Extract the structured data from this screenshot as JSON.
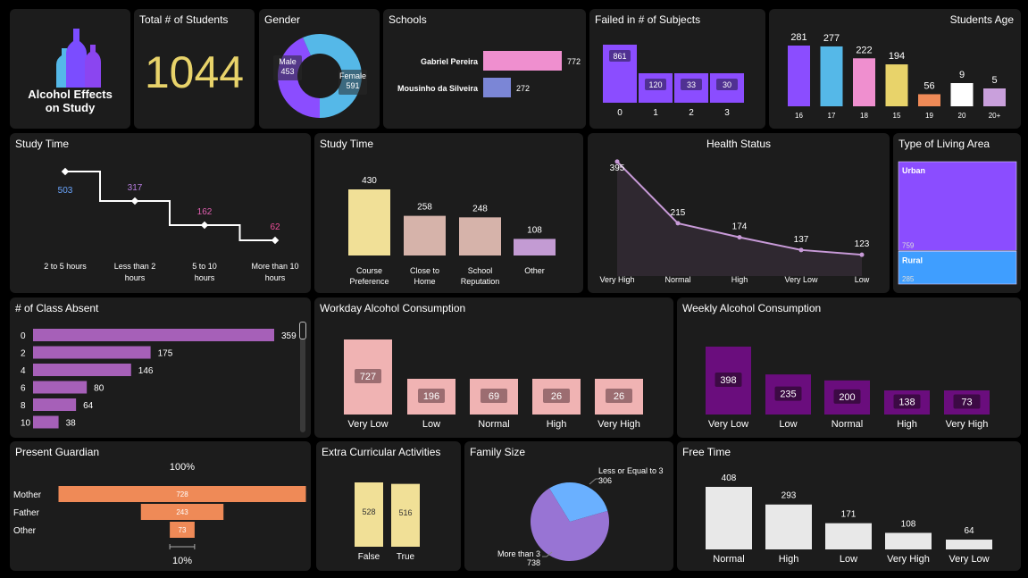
{
  "logo": {
    "title_line1": "Alcohol Effects",
    "title_line2": "on Study",
    "colors": [
      "#7b4dff",
      "#55b8e8",
      "#8b45f0"
    ]
  },
  "total": {
    "title": "Total # of Students",
    "value": "1044",
    "color": "#e8d36a"
  },
  "chart_data": [
    {
      "id": "gender",
      "type": "pie",
      "title": "Gender",
      "slices": [
        {
          "label": "Male",
          "value": 453,
          "color": "#8b4dff"
        },
        {
          "label": "Female",
          "value": 591,
          "color": "#55b8e8"
        }
      ]
    },
    {
      "id": "schools",
      "type": "bar",
      "orientation": "horizontal",
      "title": "Schools",
      "categories": [
        "Gabriel Pereira",
        "Mousinho da Silveira"
      ],
      "values": [
        772,
        272
      ],
      "colors": [
        "#ef8fcf",
        "#7b86d6"
      ]
    },
    {
      "id": "failed",
      "type": "bar",
      "title": "Failed in # of Subjects",
      "categories": [
        "0",
        "1",
        "2",
        "3"
      ],
      "values": [
        861,
        120,
        33,
        30
      ],
      "color": "#8b4dff"
    },
    {
      "id": "age",
      "type": "bar",
      "title": "Students Age",
      "categories": [
        "16",
        "17",
        "18",
        "15",
        "19",
        "20",
        "20+"
      ],
      "values": [
        281,
        277,
        222,
        194,
        56,
        9,
        5
      ],
      "colors": [
        "#8b4dff",
        "#55b8e8",
        "#ef8fcf",
        "#e8d36a",
        "#ef8a57",
        "#ffffff",
        "#c9a0dc"
      ]
    },
    {
      "id": "studytime_line",
      "type": "line",
      "title": "Study Time",
      "categories": [
        "2 to 5 hours",
        "Less than 2 hours",
        "5 to 10 hours",
        "More than 10 hours"
      ],
      "values": [
        503,
        317,
        162,
        62
      ],
      "label_colors": [
        "#6aa6ff",
        "#b67ddf",
        "#e05fb0",
        "#ef4f9a"
      ]
    },
    {
      "id": "studytime_bar",
      "type": "bar",
      "title": "Study Time",
      "categories": [
        "Course Preference",
        "Close to Home",
        "School Reputation",
        "Other"
      ],
      "values": [
        430,
        258,
        248,
        108
      ],
      "colors": [
        "#f1e097",
        "#d6b3aa",
        "#d6b3aa",
        "#c39bd3"
      ]
    },
    {
      "id": "health",
      "type": "area",
      "title": "Health Status",
      "categories": [
        "Very High",
        "Normal",
        "High",
        "Very Low",
        "Low"
      ],
      "values": [
        395,
        215,
        174,
        137,
        123
      ],
      "color": "#c89ad8"
    },
    {
      "id": "living",
      "type": "treemap",
      "title": "Type of Living Area",
      "items": [
        {
          "label": "Urban",
          "value": 759,
          "color": "#8b4dff"
        },
        {
          "label": "Rural",
          "value": 285,
          "color": "#3f9eff"
        }
      ]
    },
    {
      "id": "absent",
      "type": "bar",
      "orientation": "horizontal",
      "title": "# of Class Absent",
      "categories": [
        "0",
        "2",
        "4",
        "6",
        "8",
        "10"
      ],
      "values": [
        359,
        175,
        146,
        80,
        64,
        38
      ],
      "color": "#a660b8"
    },
    {
      "id": "workday",
      "type": "bar",
      "title": "Workday Alcohol Consumption",
      "categories": [
        "Very Low",
        "Low",
        "Normal",
        "High",
        "Very High"
      ],
      "values": [
        727,
        196,
        69,
        26,
        26
      ],
      "color": "#f0b3b3"
    },
    {
      "id": "weekly",
      "type": "bar",
      "title": "Weekly Alcohol Consumption",
      "categories": [
        "Very Low",
        "Low",
        "Normal",
        "High",
        "Very High"
      ],
      "values": [
        398,
        235,
        200,
        138,
        73
      ],
      "color": "#6a0d7d"
    },
    {
      "id": "guardian",
      "type": "funnel",
      "title": "Present Guardian",
      "categories": [
        "Mother",
        "Father",
        "Other"
      ],
      "values": [
        728,
        243,
        73
      ],
      "top_label": "100%",
      "bottom_label": "10%",
      "color": "#ef8a57"
    },
    {
      "id": "extra",
      "type": "bar",
      "title": "Extra Curricular Activities",
      "categories": [
        "False",
        "True"
      ],
      "values": [
        528,
        516
      ],
      "color": "#f1e097"
    },
    {
      "id": "family",
      "type": "pie",
      "title": "Family Size",
      "slices": [
        {
          "label": "Less or Equal to 3",
          "value": 306,
          "color": "#6ab0ff"
        },
        {
          "label": "More than 3",
          "value": 738,
          "color": "#9874d4"
        }
      ]
    },
    {
      "id": "freetime",
      "type": "bar",
      "title": "Free Time",
      "categories": [
        "Normal",
        "High",
        "Low",
        "Very High",
        "Very Low"
      ],
      "values": [
        408,
        293,
        171,
        108,
        64
      ],
      "color": "#e8e8e8"
    }
  ]
}
